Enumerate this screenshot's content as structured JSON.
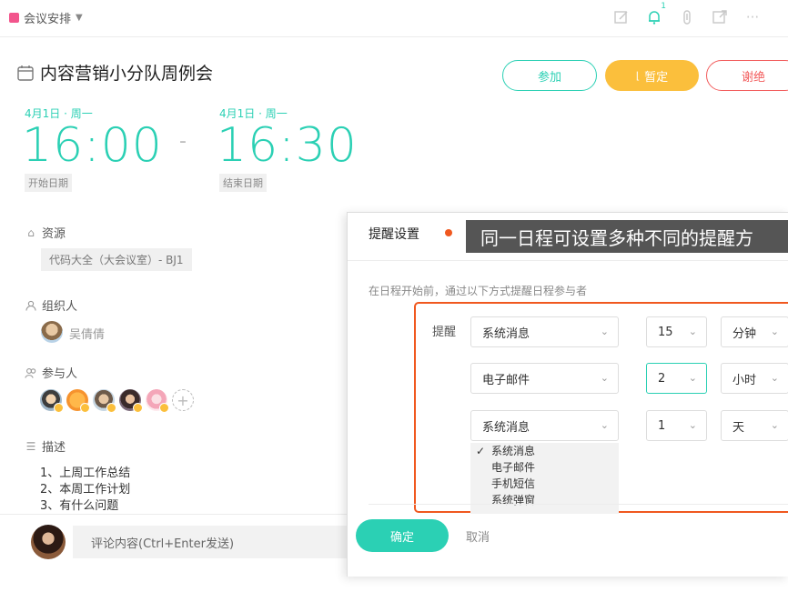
{
  "topbar": {
    "calendar_name": "会议安排",
    "calendar_color": "#f2558c",
    "bell_badge": "1"
  },
  "event": {
    "title": "内容营销小分队周例会",
    "actions": {
      "join": "参加",
      "tentative": "暂定",
      "decline": "谢绝"
    },
    "start": {
      "date": "4月1日 · 周一",
      "time": "16:00",
      "label": "开始日期"
    },
    "separator": "-",
    "end": {
      "date": "4月1日 · 周一",
      "time": "16:30",
      "label": "结束日期"
    },
    "resource": {
      "heading": "资源",
      "value": "代码大全（大会议室）- BJ1"
    },
    "organizer": {
      "heading": "组织人",
      "name": "吴倩倩"
    },
    "participants": {
      "heading": "参与人",
      "add": "+"
    },
    "description": {
      "heading": "描述",
      "lines": [
        "1、上周工作总结",
        "2、本周工作计划",
        "3、有什么问题"
      ]
    }
  },
  "comment": {
    "placeholder": "评论内容(Ctrl+Enter发送)"
  },
  "reminder_dialog": {
    "title": "提醒设置",
    "tooltip": "同一日程可设置多种不同的提醒方",
    "description": "在日程开始前，通过以下方式提醒日程参与者",
    "row_label": "提醒",
    "rows": [
      {
        "method": "系统消息",
        "amount": "15",
        "unit": "分钟"
      },
      {
        "method": "电子邮件",
        "amount": "2",
        "unit": "小时"
      },
      {
        "method": "系统消息",
        "amount": "1",
        "unit": "天"
      }
    ],
    "dropdown_options": [
      "系统消息",
      "电子邮件",
      "手机短信",
      "系统弹窗"
    ],
    "dropdown_selected_mark": "✓",
    "confirm": "确定",
    "cancel": "取消"
  },
  "colors": {
    "accent": "#2bd0b4",
    "tentative": "#fbbf3c",
    "decline": "#f25c5c",
    "highlight": "#f0581f"
  }
}
